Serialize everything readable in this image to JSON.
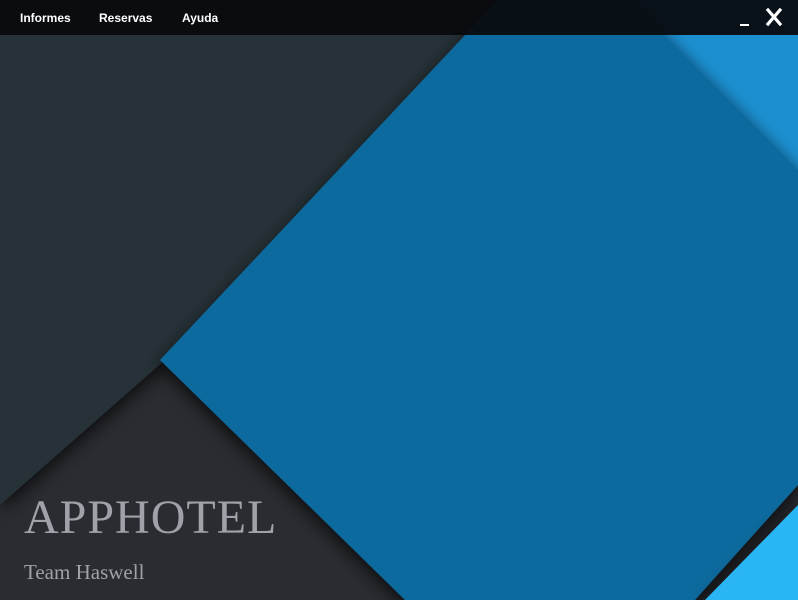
{
  "menubar": {
    "items": [
      {
        "label": "Informes"
      },
      {
        "label": "Reservas"
      },
      {
        "label": "Ayuda"
      }
    ]
  },
  "window_controls": {
    "minimize_label": "_",
    "close_label": "X"
  },
  "splash": {
    "title": "APPHOTEL",
    "subtitle": "Team Haswell"
  },
  "colors": {
    "menubar_bg": "#080a0d",
    "background_dark": "#2a2c31",
    "panel_slate": "#283139",
    "accent_blue": "#0e6a9e",
    "accent_light_blue": "#1c8fd0",
    "accent_cyan": "#2ab6f5",
    "text_muted": "#9fa2a8",
    "menu_text": "#ffffff"
  },
  "icons": {
    "minimize": "minimize-icon",
    "close": "close-icon"
  }
}
